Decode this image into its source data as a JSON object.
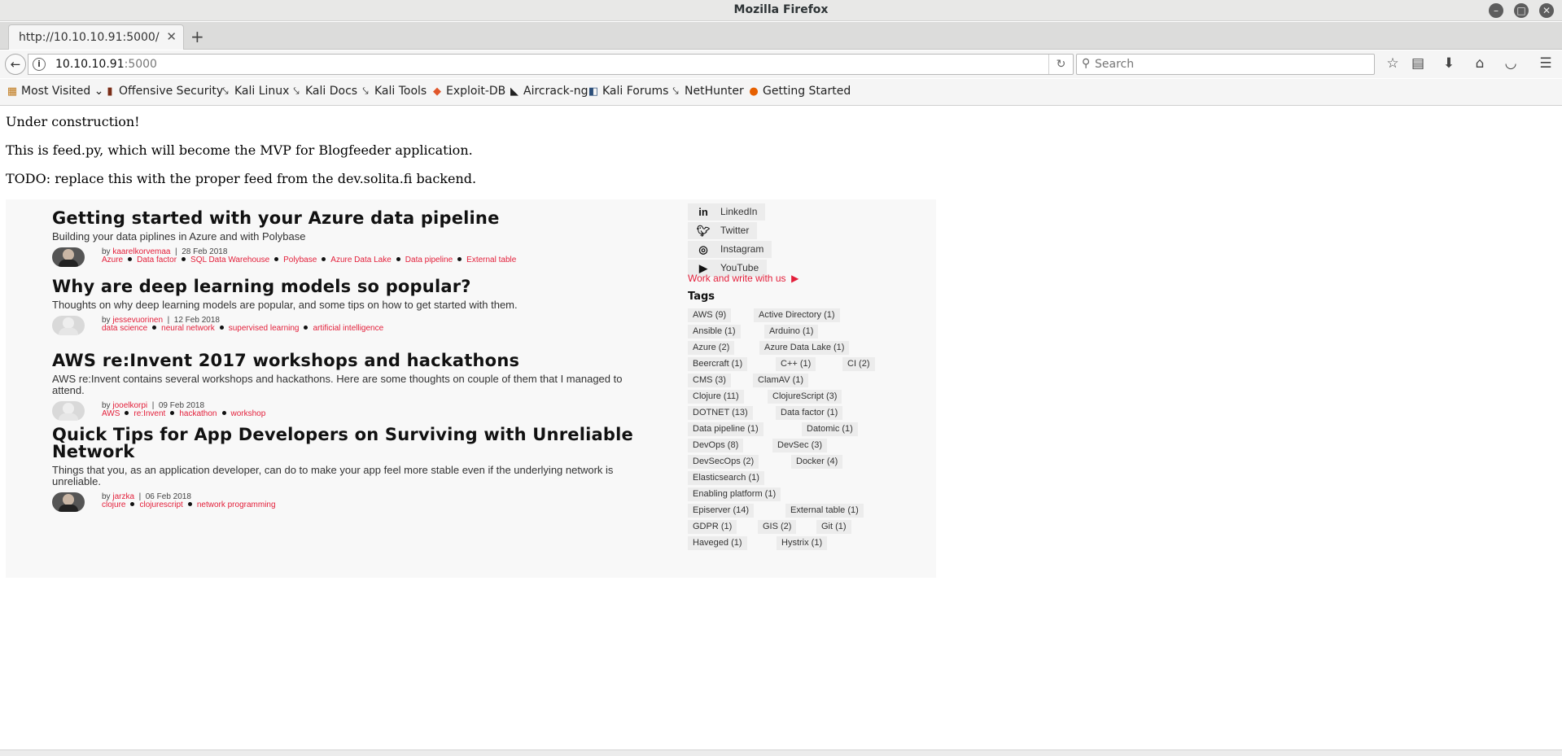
{
  "window": {
    "title": "Mozilla Firefox"
  },
  "tabs": [
    {
      "label": "http://10.10.10.91:5000/"
    }
  ],
  "address": {
    "host": "10.10.10.91",
    "port": ":5000"
  },
  "search": {
    "placeholder": "Search"
  },
  "bookmarks": [
    {
      "label": "Most Visited",
      "icon": "most-visited-icon",
      "dropdown": true
    },
    {
      "label": "Offensive Security",
      "icon": "offsec-icon"
    },
    {
      "label": "Kali Linux",
      "icon": "kali-icon"
    },
    {
      "label": "Kali Docs",
      "icon": "kali-icon"
    },
    {
      "label": "Kali Tools",
      "icon": "kali-icon"
    },
    {
      "label": "Exploit-DB",
      "icon": "exploit-db-icon"
    },
    {
      "label": "Aircrack-ng",
      "icon": "aircrack-icon"
    },
    {
      "label": "Kali Forums",
      "icon": "forums-icon"
    },
    {
      "label": "NetHunter",
      "icon": "kali-icon"
    },
    {
      "label": "Getting Started",
      "icon": "firefox-icon"
    }
  ],
  "page": {
    "lines": [
      "Under construction!",
      "This is feed.py, which will become the MVP for Blogfeeder application.",
      "TODO: replace this with the proper feed from the dev.solita.fi backend."
    ]
  },
  "feed": {
    "posts": [
      {
        "title": "Getting started with your Azure data pipeline",
        "desc": "Building your data piplines in Azure and with Polybase",
        "author": "kaarelkorvemaa",
        "date": "28 Feb 2018",
        "tags": [
          "Azure",
          "Data factor",
          "SQL Data Warehouse",
          "Polybase",
          "Azure Data Lake",
          "Data pipeline",
          "External table"
        ]
      },
      {
        "title": "Why are deep learning models so popular?",
        "desc": "Thoughts on why deep learning models are popular, and some tips on how to get started with them.",
        "author": "jessevuorinen",
        "date": "12 Feb 2018",
        "tags": [
          "data science",
          "neural network",
          "supervised learning",
          "artificial intelligence"
        ]
      },
      {
        "title": "AWS re:Invent 2017 workshops and hackathons",
        "desc": "AWS re:Invent contains several workshops and hackathons. Here are some thoughts on couple of them that I managed to attend.",
        "author": "jooelkorpi",
        "date": "09 Feb 2018",
        "tags": [
          "AWS",
          "re:Invent",
          "hackathon",
          "workshop"
        ]
      },
      {
        "title": "Quick Tips for App Developers on Surviving with Unreliable Network",
        "desc": "Things that you, as an application developer, can do to make your app feel more stable even if the underlying network is unreliable.",
        "author": "jarzka",
        "date": "06 Feb 2018",
        "tags": [
          "clojure",
          "clojurescript",
          "network programming"
        ]
      }
    ],
    "social": [
      {
        "label": "LinkedIn",
        "icon": "linkedin-icon"
      },
      {
        "label": "Twitter",
        "icon": "twitter-icon"
      },
      {
        "label": "Instagram",
        "icon": "instagram-icon"
      },
      {
        "label": "YouTube",
        "icon": "youtube-icon"
      }
    ],
    "work_link": "Work and write with us",
    "tags_heading": "Tags",
    "tags": [
      "AWS (9)",
      "Active Directory (1)",
      "Ansible (1)",
      "Arduino (1)",
      "Azure (2)",
      "Azure Data Lake (1)",
      "Beercraft (1)",
      "C++ (1)",
      "CI (2)",
      "CMS (3)",
      "ClamAV (1)",
      "Clojure (11)",
      "ClojureScript (3)",
      "DOTNET (13)",
      "Data factor (1)",
      "Data pipeline (1)",
      "Datomic (1)",
      "DevOps (8)",
      "DevSec (3)",
      "DevSecOps (2)",
      "Docker (4)",
      "Elasticsearch (1)",
      "Enabling platform (1)",
      "Episerver (14)",
      "External table (1)",
      "GDPR (1)",
      "GIS (2)",
      "Git (1)",
      "Haveged (1)",
      "Hystrix (1)"
    ]
  },
  "colors": {
    "accent": "#e31f3a",
    "chrome": "#f5f5f5"
  }
}
